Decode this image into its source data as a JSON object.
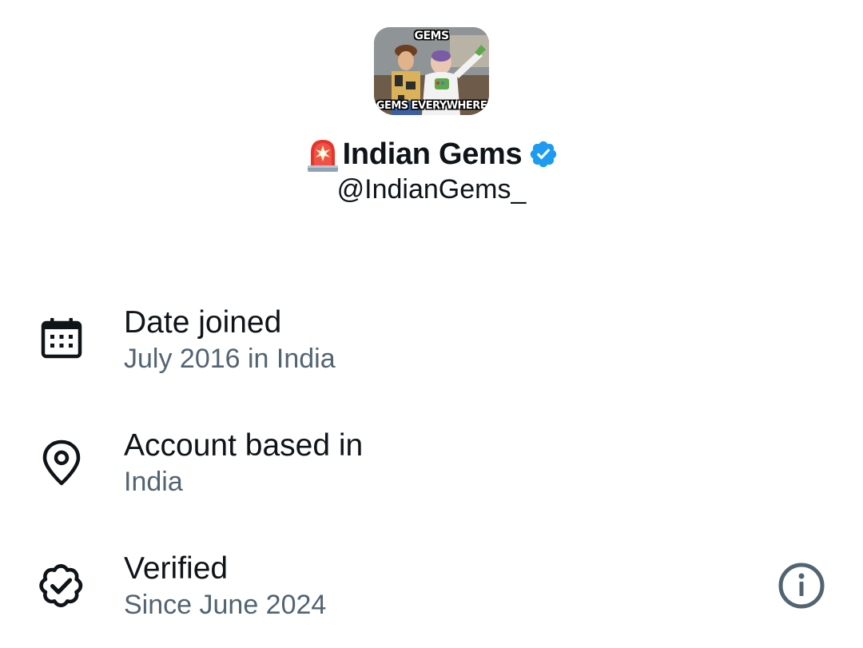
{
  "profile": {
    "avatar_caption_top": "GEMS",
    "avatar_caption_bottom": "GEMS EVERYWHERE",
    "display_name": "Indian Gems",
    "handle": "@IndianGems_",
    "siren_icon": "police-siren-emoji",
    "badge_icon": "verified-badge-icon",
    "badge_color": "#1d9bf0"
  },
  "about": {
    "items": [
      {
        "icon": "calendar-icon",
        "title": "Date joined",
        "value": "July 2016 in India"
      },
      {
        "icon": "location-pin-icon",
        "title": "Account based in",
        "value": "India"
      },
      {
        "icon": "verified-seal-icon",
        "title": "Verified",
        "value": "Since June 2024",
        "action_icon": "info-icon"
      }
    ]
  },
  "colors": {
    "primary_text": "#0f1419",
    "secondary_text": "#536471",
    "background": "#ffffff"
  }
}
